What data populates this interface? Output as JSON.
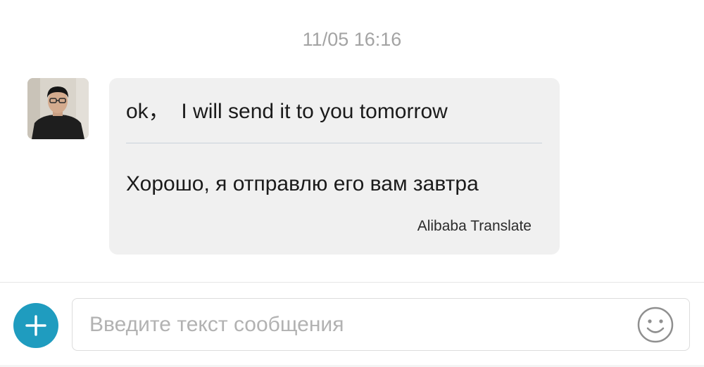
{
  "chat": {
    "timestamp": "11/05 16:16",
    "message": {
      "original_text": "ok，  I will send it to you tomorrow",
      "translated_text": "Хорошо, я отправлю его вам завтра",
      "translator_label": "Alibaba Translate"
    }
  },
  "composer": {
    "placeholder": "Введите текст сообщения",
    "value": "",
    "add_icon": "plus-icon",
    "emoji_icon": "smiley-icon"
  },
  "colors": {
    "accent": "#1f9cbf",
    "bubble_background": "#f0f0f0",
    "timestamp_text": "#a3a3a3",
    "placeholder_text": "#b2b2b2"
  }
}
